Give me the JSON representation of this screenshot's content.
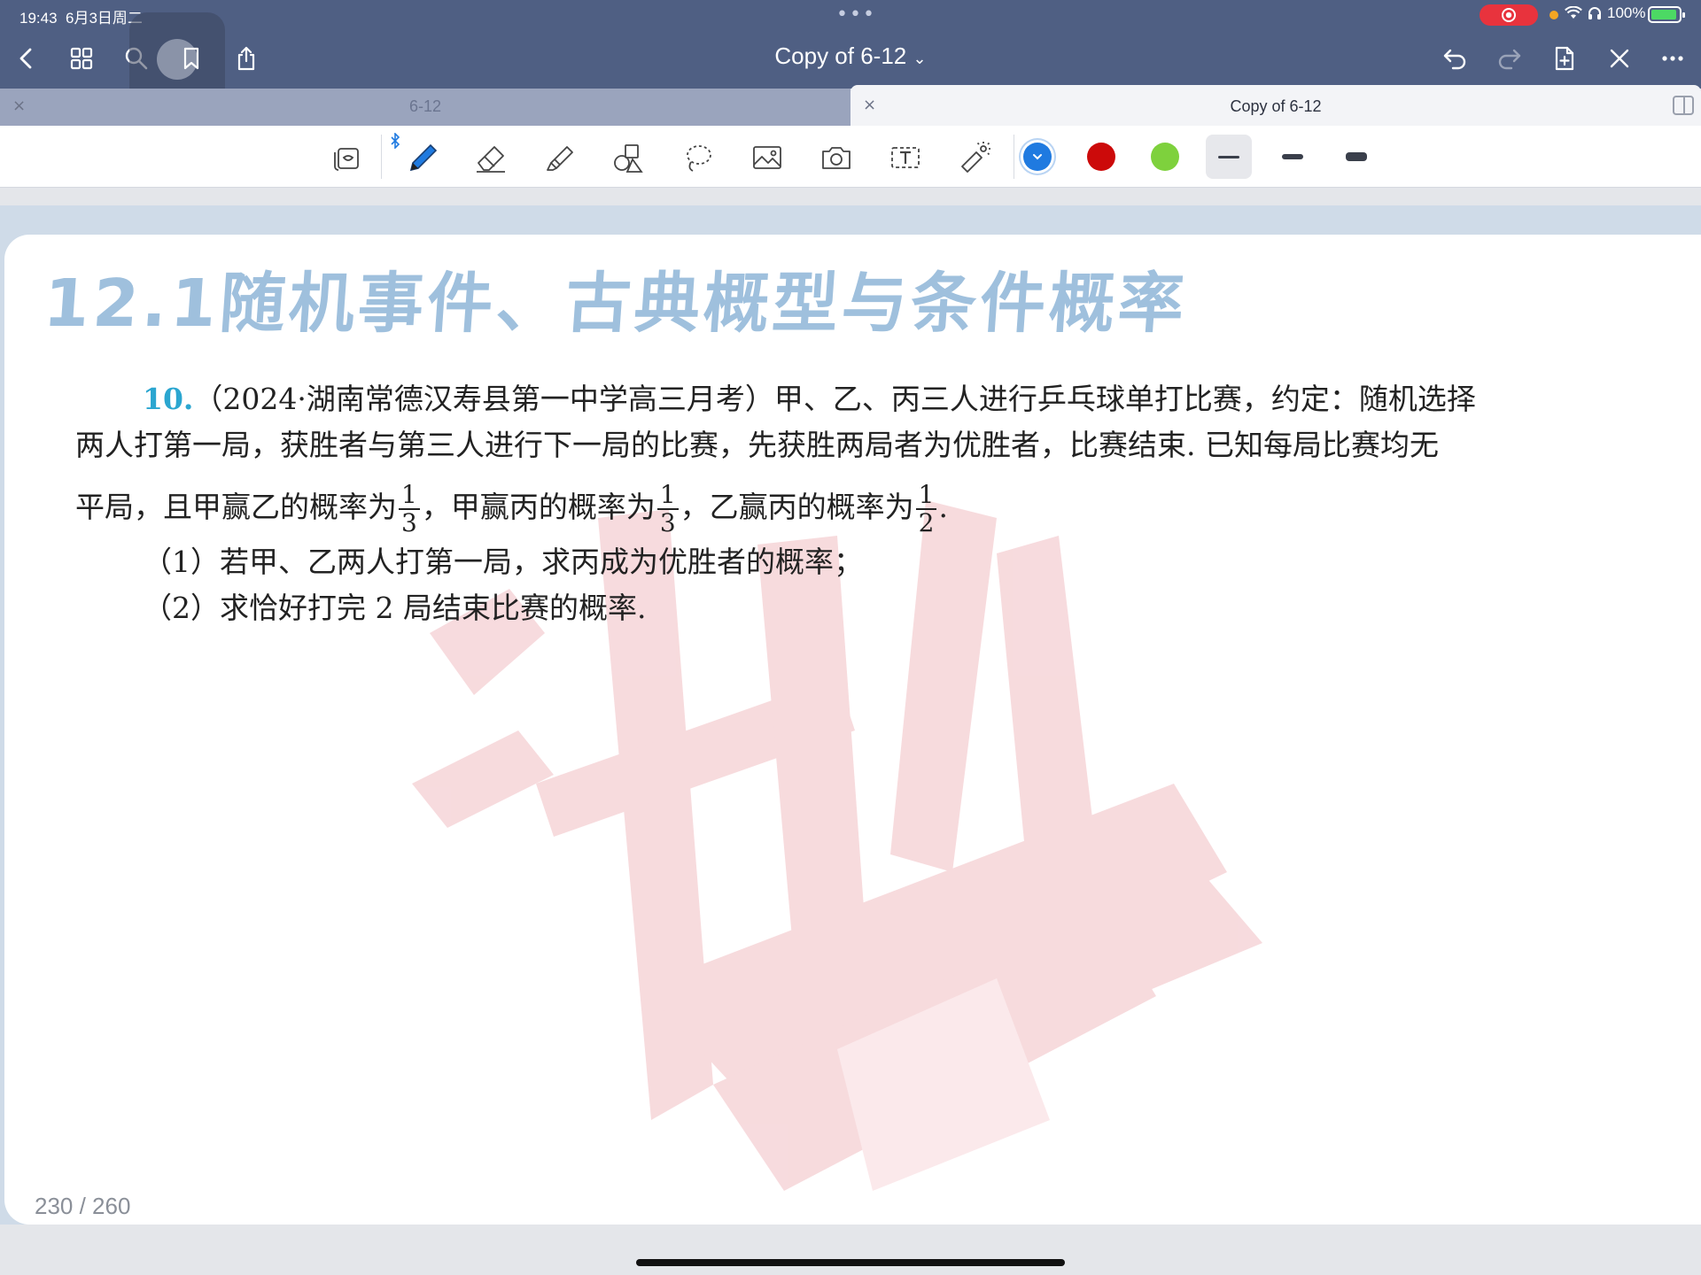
{
  "status_bar": {
    "time": "19:43",
    "date": "6月3日周二",
    "multitask_dots": "•••",
    "battery": "100%"
  },
  "nav": {
    "title": "Copy of 6-12",
    "title_caret": "⌄"
  },
  "tabs": [
    {
      "label": "6-12",
      "active": false,
      "close": "×"
    },
    {
      "label": "Copy of 6-12",
      "active": true,
      "close": "×"
    }
  ],
  "toolbar": {
    "tools": [
      "lasso-select",
      "pen",
      "eraser",
      "highlighter",
      "shapes",
      "lasso",
      "image",
      "camera",
      "text",
      "laser-pointer"
    ],
    "colors": [
      {
        "name": "blue",
        "hex": "#1f7ae0",
        "selected": true
      },
      {
        "name": "red",
        "hex": "#cc0a0a",
        "selected": false
      },
      {
        "name": "green",
        "hex": "#7ed13d",
        "selected": false
      }
    ],
    "strokes": [
      "thin",
      "medium",
      "thick"
    ],
    "selected_stroke": "thin"
  },
  "document": {
    "chapter_title": "12.1随机事件、古典概型与条件概率",
    "question_number": "10.",
    "question_source": "（2024·湖南常德汉寿县第一中学高三月考）",
    "question_line1_rest": "甲、乙、丙三人进行乒乓球单打比赛，约定：随机选择",
    "question_line2": "两人打第一局，获胜者与第三人进行下一局的比赛，先获胜两局者为优胜者，比赛结束. 已知每局比赛均无",
    "line3_part1": "平局，且甲赢乙的概率为",
    "line3_part2": "，甲赢丙的概率为",
    "line3_part3": "，乙赢丙的概率为",
    "line3_end": ".",
    "frac1": {
      "num": "1",
      "den": "3"
    },
    "frac2": {
      "num": "1",
      "den": "3"
    },
    "frac3": {
      "num": "1",
      "den": "2"
    },
    "sub1": "（1）若甲、乙两人打第一局，求丙成为优胜者的概率；",
    "sub2": "（2）求恰好打完 2 局结束比赛的概率.",
    "page_counter": "230 / 260"
  },
  "colors": {
    "nav_bg": "#4f5f83",
    "title_blue": "#9fc0dd",
    "qnum_blue": "#2ba6d0",
    "watermark_red": "#f3c9cc"
  }
}
